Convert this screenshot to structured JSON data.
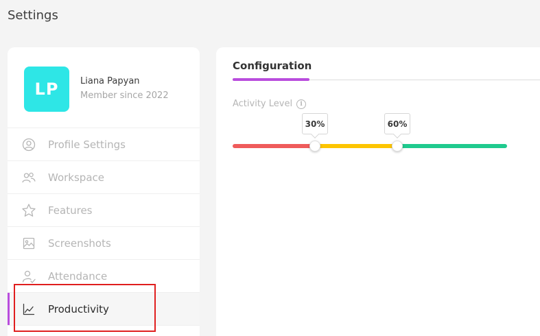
{
  "page": {
    "title": "Settings"
  },
  "profile": {
    "initials": "LP",
    "name": "Liana Papyan",
    "member_since": "Member since 2022",
    "avatar_color": "#2ee6e6"
  },
  "sidebar": {
    "items": [
      {
        "label": "Profile Settings",
        "icon": "user-circle-icon",
        "active": false
      },
      {
        "label": "Workspace",
        "icon": "users-icon",
        "active": false
      },
      {
        "label": "Features",
        "icon": "star-icon",
        "active": false
      },
      {
        "label": "Screenshots",
        "icon": "image-icon",
        "active": false
      },
      {
        "label": "Attendance",
        "icon": "user-check-icon",
        "active": false
      },
      {
        "label": "Productivity",
        "icon": "line-chart-icon",
        "active": true
      }
    ],
    "accent_color": "#b94cdd"
  },
  "main": {
    "tab_label": "Configuration",
    "activity_label": "Activity Level",
    "slider": {
      "low_threshold": "30%",
      "high_threshold": "60%",
      "low_value": 30,
      "high_value": 60,
      "colors": {
        "low": "#ef5b5b",
        "mid": "#fdc500",
        "high": "#1fca8e"
      }
    }
  }
}
